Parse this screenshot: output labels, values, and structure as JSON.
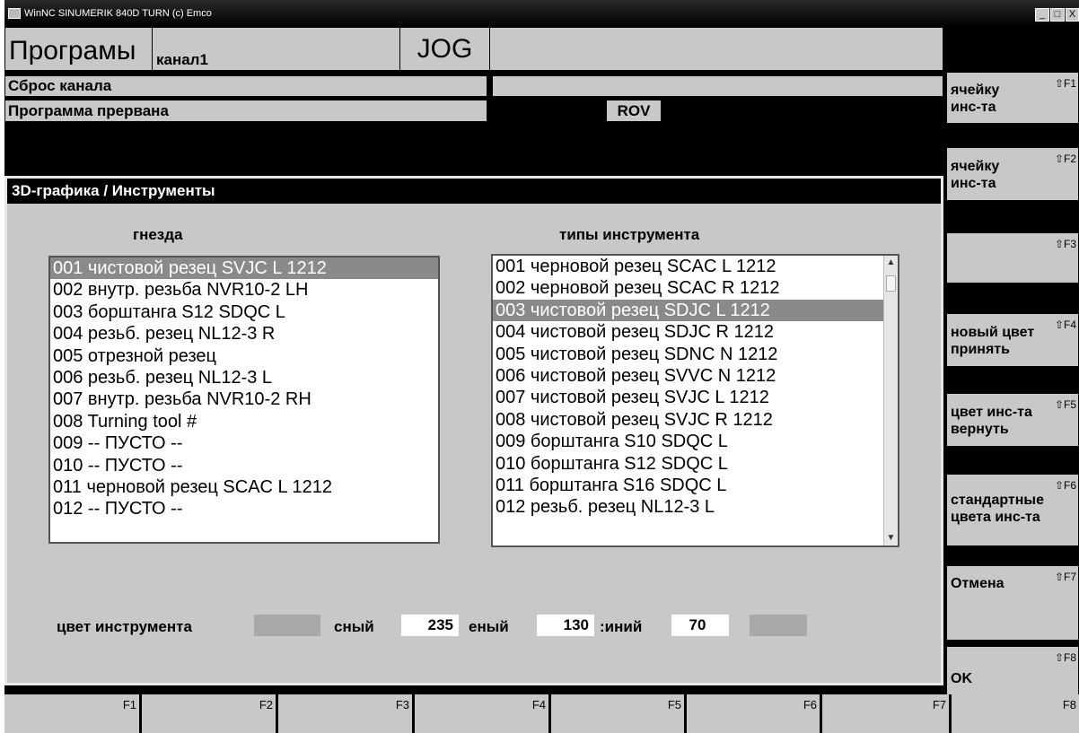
{
  "window": {
    "title": "WinNC SINUMERIK 840D TURN (c) Emco",
    "btn_min": "_",
    "btn_max": "□",
    "btn_close": "X"
  },
  "header": {
    "mode_area": "Програмы",
    "channel": "канал1",
    "op_mode": "JOG",
    "status1": "Сброс канала",
    "status2": "Программа прервана",
    "rov": "ROV"
  },
  "softkeys_right": [
    {
      "line1": "ячейку",
      "line2": "инс-та",
      "fkey": "⇧F1"
    },
    {
      "line1": "ячейку",
      "line2": "инс-та",
      "fkey": "⇧F2"
    },
    {
      "line1": "",
      "line2": "",
      "fkey": "⇧F3"
    },
    {
      "line1": "новый цвет",
      "line2": "принять",
      "fkey": "⇧F4"
    },
    {
      "line1": "цвет инс-та",
      "line2": "вернуть",
      "fkey": "⇧F5"
    },
    {
      "line1": "стандартные",
      "line2": "цвета инс-та",
      "fkey": "⇧F6"
    },
    {
      "line1": "",
      "line2": "Отмена",
      "fkey": "⇧F7"
    },
    {
      "line1": "OK",
      "line2": "",
      "fkey": "⇧F8"
    }
  ],
  "dialog": {
    "title": "3D-графика / Инструменты",
    "left_header": "гнезда",
    "right_header": "типы инструмента",
    "left_list": [
      "001 чистовой резец SVJC L 1212",
      "002 внутр. резьба NVR10-2 LH",
      "003 борштанга S12 SDQC L",
      "004 резьб. резец NL12-3 R",
      "005 отрезной резец",
      "006 резьб. резец NL12-3 L",
      "007 внутр. резьба NVR10-2 RH",
      "008 Turning tool #",
      "009 -- ПУСТО --",
      "010 -- ПУСТО --",
      "011 черновой резец SCAC L 1212",
      "012 -- ПУСТО --"
    ],
    "left_selected": 0,
    "right_list": [
      "001 черновой резец SCAC L 1212",
      "002 черновой резец SCAC R 1212",
      "003 чистовой резец SDJC L 1212",
      "004 чистовой резец SDJC R 1212",
      "005 чистовой резец SDNC N 1212",
      "006 чистовой резец SVVC N 1212",
      "007 чистовой резец SVJC L 1212",
      "008 чистовой резец SVJC R 1212",
      "009 борштанга S10 SDQC L",
      "010 борштанга S12 SDQC L",
      "011 борштанга S16 SDQC L",
      "012 резьб. резец NL12-3 L"
    ],
    "right_selected": 2,
    "color_label": "цвет инструмента",
    "red_label": "сный",
    "red_value": "235",
    "green_label": "еный",
    "green_value": "130",
    "blue_label": ":иний",
    "blue_value": "70"
  },
  "fkeys_bottom": [
    "F1",
    "F2",
    "F3",
    "F4",
    "F5",
    "F6",
    "F7",
    "F8"
  ]
}
